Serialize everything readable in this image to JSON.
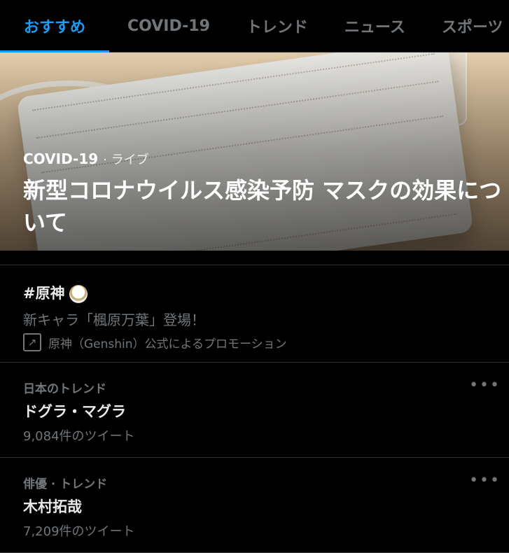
{
  "tabs": [
    {
      "label": "おすすめ",
      "active": true
    },
    {
      "label": "COVID-19",
      "active": false
    },
    {
      "label": "トレンド",
      "active": false
    },
    {
      "label": "ニュース",
      "active": false
    },
    {
      "label": "スポーツ",
      "active": false
    }
  ],
  "hero": {
    "category": "COVID-19",
    "live": "· ライブ",
    "title": "新型コロナウイルス感染予防 マスクの効果について"
  },
  "promo": {
    "tag": "#原神",
    "description": "新キャラ「楓原万葉」登場！",
    "promoted_by": "原神（Genshin）公式によるプロモーション",
    "icon": "promoted-arrow-icon"
  },
  "trends": [
    {
      "context": "日本のトレンド",
      "name": "ドグラ・マグラ",
      "count": "9,084件のツイート"
    },
    {
      "context": "俳優 · トレンド",
      "name": "木村拓哉",
      "count": "7,209件のツイート"
    }
  ],
  "colors": {
    "accent": "#1d9bf0",
    "background": "#000000",
    "muted": "#71767b",
    "text": "#e7e9ea",
    "divider": "#2f3336"
  }
}
